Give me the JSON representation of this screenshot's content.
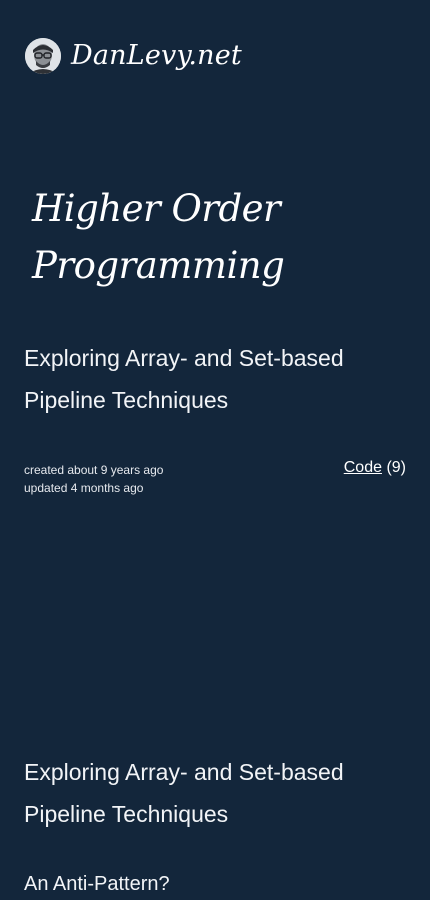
{
  "site": {
    "title": "DanLevy.net",
    "avatar_icon": "author-avatar"
  },
  "post": {
    "title": "Higher Order Programming",
    "subtitle": "Exploring Array- and Set-based Pipeline Techniques",
    "created": "created about 9 years ago",
    "updated": "updated 4 months ago",
    "code_label": "Code",
    "code_count": "(9)"
  },
  "content": {
    "heading": "Exploring Array- and Set-based Pipeline Techniques",
    "section": "An Anti-Pattern?"
  },
  "colors": {
    "background": "#13263b",
    "text": "#ffffff"
  }
}
